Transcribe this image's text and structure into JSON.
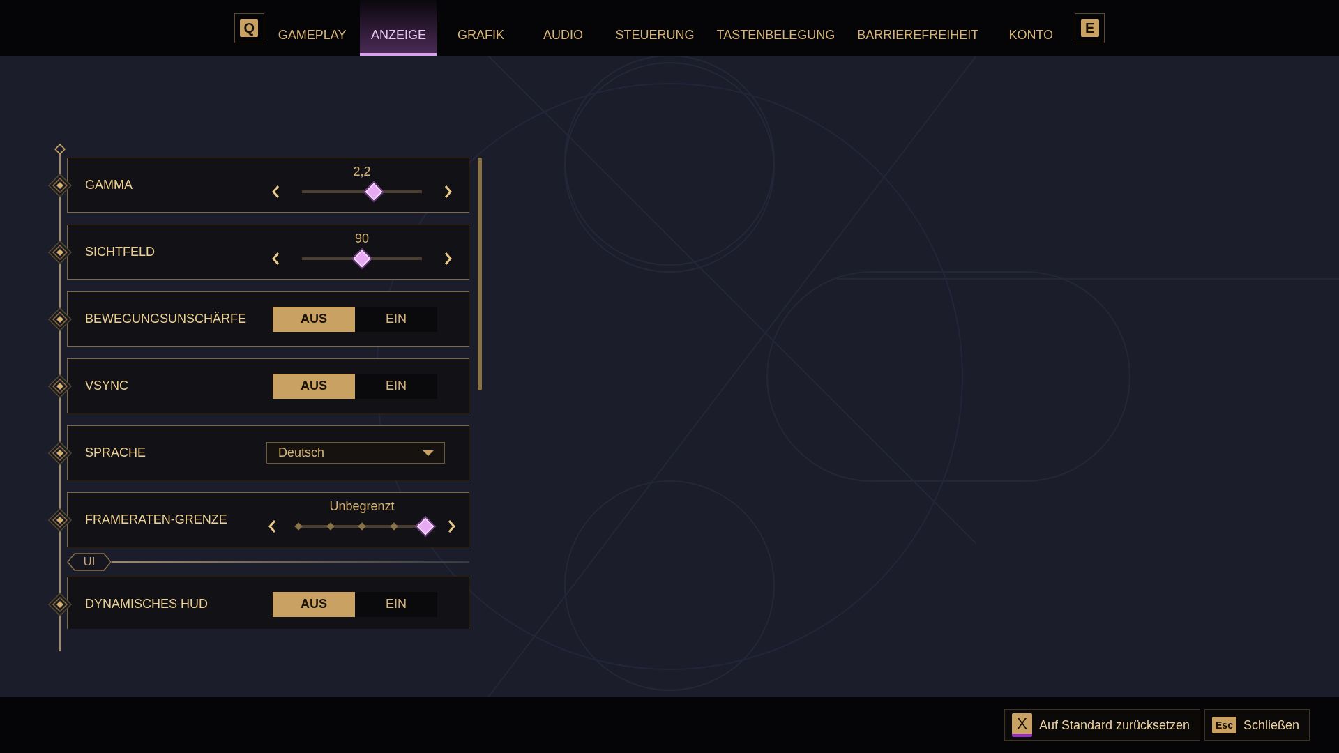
{
  "nav": {
    "left_key": "Q",
    "right_key": "E",
    "tabs": [
      {
        "label": "GAMEPLAY",
        "selected": false
      },
      {
        "label": "ANZEIGE",
        "selected": true
      },
      {
        "label": "GRAFIK",
        "selected": false
      },
      {
        "label": "AUDIO",
        "selected": false
      },
      {
        "label": "STEUERUNG",
        "selected": false
      },
      {
        "label": "TASTENBELEGUNG",
        "selected": false
      },
      {
        "label": "BARRIEREFREIHEIT",
        "selected": false
      },
      {
        "label": "KONTO",
        "selected": false
      }
    ]
  },
  "settings": [
    {
      "kind": "slider",
      "label": "GAMMA",
      "reading": "2,2",
      "level": 0.6
    },
    {
      "kind": "slider",
      "label": "SICHTFELD",
      "reading": "90",
      "level": 0.5
    },
    {
      "kind": "toggle",
      "label": "BEWEGUNGSUNSCHÄRFE",
      "options": [
        {
          "label": "AUS",
          "selected": true
        },
        {
          "label": "EIN",
          "selected": false
        }
      ]
    },
    {
      "kind": "toggle",
      "label": "VSYNC",
      "options": [
        {
          "label": "AUS",
          "selected": true
        },
        {
          "label": "EIN",
          "selected": false
        }
      ]
    },
    {
      "kind": "dropdown",
      "label": "SPRACHE",
      "value": "Deutsch"
    },
    {
      "kind": "stepper",
      "label": "FRAMERATEN-GRENZE",
      "reading": "Unbegrenzt",
      "level": 1
    },
    {
      "kind": "section",
      "label": "UI"
    },
    {
      "kind": "toggle",
      "label": "DYNAMISCHES HUD",
      "options": [
        {
          "label": "AUS",
          "selected": true
        },
        {
          "label": "EIN",
          "selected": false
        }
      ]
    }
  ],
  "footer": {
    "buttons": [
      {
        "key": "X",
        "label": "Auf Standard zurücksetzen"
      },
      {
        "key": "Esc",
        "label": "Schließen"
      }
    ]
  }
}
